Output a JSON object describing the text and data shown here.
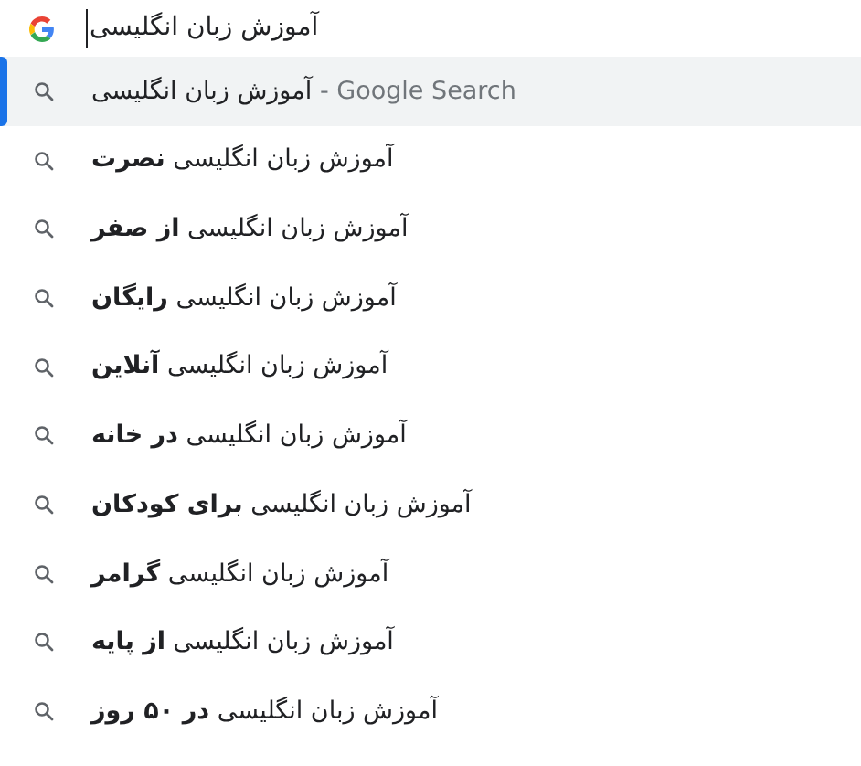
{
  "search_box": {
    "value": "آموزش زبان انگلیسی"
  },
  "suggestions": [
    {
      "text": "آموزش زبان انگلیسی",
      "suffix": " - Google Search",
      "selected": true
    },
    {
      "text": "آموزش زبان انگلیسی **نصرت**",
      "selected": false
    },
    {
      "text": "آموزش زبان انگلیسی **از صفر**",
      "selected": false
    },
    {
      "text": "آموزش زبان انگلیسی **رایگان**",
      "selected": false
    },
    {
      "text": "آموزش زبان انگلیسی **آنلاین**",
      "selected": false
    },
    {
      "text": "آموزش زبان انگلیسی **در خانه**",
      "selected": false
    },
    {
      "text": "آموزش زبان انگلیسی **برای کودکان**",
      "selected": false
    },
    {
      "text": "آموزش زبان انگلیسی **گرامر**",
      "selected": false
    },
    {
      "text": "آموزش زبان انگلیسی **از پایه**",
      "selected": false
    },
    {
      "text": "آموزش زبان انگلیسی **در ۵۰ روز**",
      "selected": false
    }
  ]
}
